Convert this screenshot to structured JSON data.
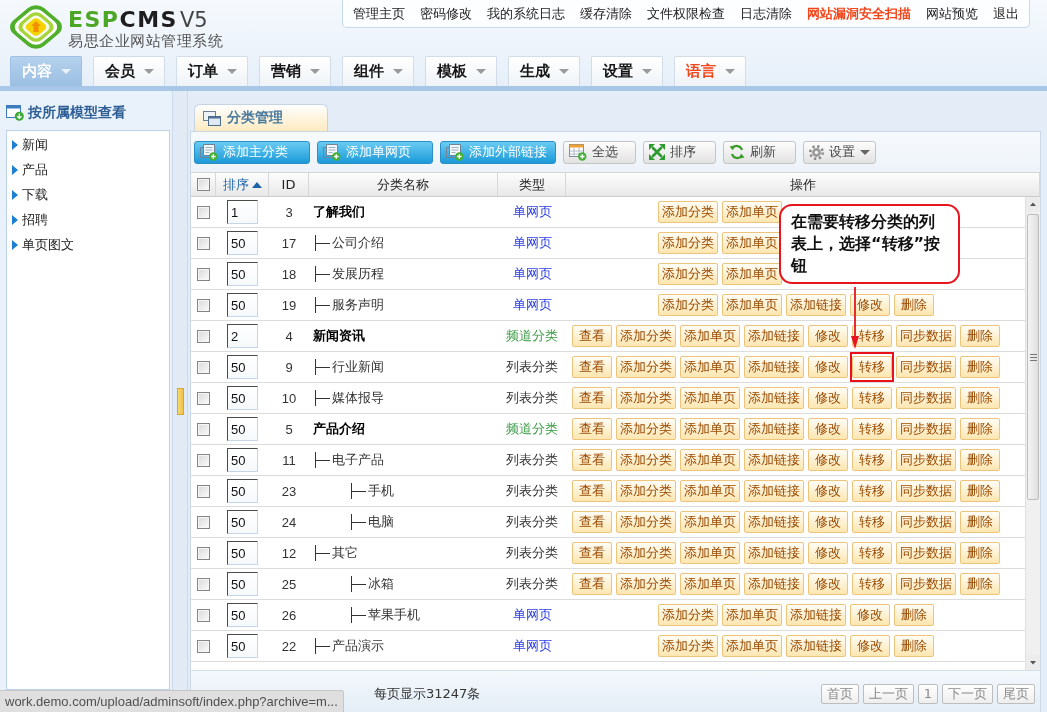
{
  "logo": {
    "wordmark_accent": "ESP",
    "wordmark_rest": "CMS",
    "version": "V5",
    "subtitle": "易思企业网站管理系统"
  },
  "top_links": [
    {
      "label": "管理主页",
      "kind": "normal"
    },
    {
      "label": "密码修改",
      "kind": "normal"
    },
    {
      "label": "我的系统日志",
      "kind": "normal"
    },
    {
      "label": "缓存清除",
      "kind": "normal"
    },
    {
      "label": "文件权限检查",
      "kind": "normal"
    },
    {
      "label": "日志清除",
      "kind": "normal"
    },
    {
      "label": "网站漏洞安全扫描",
      "kind": "alert"
    },
    {
      "label": "网站预览",
      "kind": "normal"
    },
    {
      "label": "退出",
      "kind": "normal"
    }
  ],
  "main_menu": [
    {
      "label": "内容",
      "selected": true,
      "kind": "normal"
    },
    {
      "label": "会员",
      "selected": false,
      "kind": "normal"
    },
    {
      "label": "订单",
      "selected": false,
      "kind": "normal"
    },
    {
      "label": "营销",
      "selected": false,
      "kind": "normal"
    },
    {
      "label": "组件",
      "selected": false,
      "kind": "normal"
    },
    {
      "label": "模板",
      "selected": false,
      "kind": "normal"
    },
    {
      "label": "生成",
      "selected": false,
      "kind": "normal"
    },
    {
      "label": "设置",
      "selected": false,
      "kind": "normal"
    },
    {
      "label": "语言",
      "selected": false,
      "kind": "alert"
    }
  ],
  "sidebar": {
    "title": "按所属模型查看",
    "items": [
      "新闻",
      "产品",
      "下载",
      "招聘",
      "单页图文"
    ]
  },
  "panel_tab": {
    "label": "分类管理"
  },
  "toolbar": [
    {
      "label": "添加主分类",
      "kind": "primary"
    },
    {
      "label": "添加单网页",
      "kind": "primary"
    },
    {
      "label": "添加外部链接",
      "kind": "primary"
    },
    {
      "label": "全选",
      "kind": "secondary"
    },
    {
      "label": "排序",
      "kind": "secondary"
    },
    {
      "label": "刷新",
      "kind": "secondary"
    },
    {
      "label": "设置",
      "kind": "dropdown"
    }
  ],
  "table": {
    "select_all": {
      "checked": false
    },
    "columns": [
      {
        "label": "排序",
        "sorted": true
      },
      {
        "label": "ID",
        "sorted": false
      },
      {
        "label": "分类名称",
        "sorted": false
      },
      {
        "label": "类型",
        "sorted": false
      },
      {
        "label": "操作",
        "sorted": false
      }
    ],
    "rows": [
      {
        "checked": false,
        "order": "1",
        "id": "3",
        "name": "了解我们",
        "type": {
          "label": "单网页",
          "kind": "page"
        },
        "actions": [
          {
            "label": "添加分类",
            "highlighted": false
          },
          {
            "label": "添加单页",
            "highlighted": false
          }
        ],
        "children": [
          {
            "checked": false,
            "order": "50",
            "id": "17",
            "name": "公司介绍",
            "type": {
              "label": "单网页",
              "kind": "page"
            },
            "actions": [
              {
                "label": "添加分类",
                "highlighted": false
              },
              {
                "label": "添加单页",
                "highlighted": false
              }
            ]
          },
          {
            "checked": false,
            "order": "50",
            "id": "18",
            "name": "发展历程",
            "type": {
              "label": "单网页",
              "kind": "page"
            },
            "actions": [
              {
                "label": "添加分类",
                "highlighted": false
              },
              {
                "label": "添加单页",
                "highlighted": false
              }
            ]
          },
          {
            "checked": false,
            "order": "50",
            "id": "19",
            "name": "服务声明",
            "type": {
              "label": "单网页",
              "kind": "page"
            },
            "actions": [
              {
                "label": "添加分类",
                "highlighted": false
              },
              {
                "label": "添加单页",
                "highlighted": false
              },
              {
                "label": "添加链接",
                "highlighted": false
              },
              {
                "label": "修改",
                "highlighted": false
              },
              {
                "label": "删除",
                "highlighted": false
              }
            ]
          }
        ]
      },
      {
        "checked": false,
        "order": "2",
        "id": "4",
        "name": "新闻资讯",
        "type": {
          "label": "频道分类",
          "kind": "channel"
        },
        "actions": [
          {
            "label": "查看",
            "highlighted": false
          },
          {
            "label": "添加分类",
            "highlighted": false
          },
          {
            "label": "添加单页",
            "highlighted": false
          },
          {
            "label": "添加链接",
            "highlighted": false
          },
          {
            "label": "修改",
            "highlighted": false
          },
          {
            "label": "转移",
            "highlighted": false
          },
          {
            "label": "同步数据",
            "highlighted": false
          },
          {
            "label": "删除",
            "highlighted": false
          }
        ],
        "children": [
          {
            "checked": false,
            "order": "50",
            "id": "9",
            "name": "行业新闻",
            "type": {
              "label": "列表分类",
              "kind": "list"
            },
            "actions": [
              {
                "label": "查看",
                "highlighted": false
              },
              {
                "label": "添加分类",
                "highlighted": false
              },
              {
                "label": "添加单页",
                "highlighted": false
              },
              {
                "label": "添加链接",
                "highlighted": false
              },
              {
                "label": "修改",
                "highlighted": false
              },
              {
                "label": "转移",
                "highlighted": true
              },
              {
                "label": "同步数据",
                "highlighted": false
              },
              {
                "label": "删除",
                "highlighted": false
              }
            ]
          },
          {
            "checked": false,
            "order": "50",
            "id": "10",
            "name": "媒体报导",
            "type": {
              "label": "列表分类",
              "kind": "list"
            },
            "actions": [
              {
                "label": "查看",
                "highlighted": false
              },
              {
                "label": "添加分类",
                "highlighted": false
              },
              {
                "label": "添加单页",
                "highlighted": false
              },
              {
                "label": "添加链接",
                "highlighted": false
              },
              {
                "label": "修改",
                "highlighted": false
              },
              {
                "label": "转移",
                "highlighted": false
              },
              {
                "label": "同步数据",
                "highlighted": false
              },
              {
                "label": "删除",
                "highlighted": false
              }
            ]
          }
        ]
      },
      {
        "checked": false,
        "order": "50",
        "id": "5",
        "name": "产品介绍",
        "type": {
          "label": "频道分类",
          "kind": "channel"
        },
        "actions": [
          {
            "label": "查看",
            "highlighted": false
          },
          {
            "label": "添加分类",
            "highlighted": false
          },
          {
            "label": "添加单页",
            "highlighted": false
          },
          {
            "label": "添加链接",
            "highlighted": false
          },
          {
            "label": "修改",
            "highlighted": false
          },
          {
            "label": "转移",
            "highlighted": false
          },
          {
            "label": "同步数据",
            "highlighted": false
          },
          {
            "label": "删除",
            "highlighted": false
          }
        ],
        "children": [
          {
            "checked": false,
            "order": "50",
            "id": "11",
            "name": "电子产品",
            "type": {
              "label": "列表分类",
              "kind": "list"
            },
            "actions": [
              {
                "label": "查看",
                "highlighted": false
              },
              {
                "label": "添加分类",
                "highlighted": false
              },
              {
                "label": "添加单页",
                "highlighted": false
              },
              {
                "label": "添加链接",
                "highlighted": false
              },
              {
                "label": "修改",
                "highlighted": false
              },
              {
                "label": "转移",
                "highlighted": false
              },
              {
                "label": "同步数据",
                "highlighted": false
              },
              {
                "label": "删除",
                "highlighted": false
              }
            ],
            "children": [
              {
                "checked": false,
                "order": "50",
                "id": "23",
                "name": "手机",
                "type": {
                  "label": "列表分类",
                  "kind": "list"
                },
                "actions": [
                  {
                    "label": "查看",
                    "highlighted": false
                  },
                  {
                    "label": "添加分类",
                    "highlighted": false
                  },
                  {
                    "label": "添加单页",
                    "highlighted": false
                  },
                  {
                    "label": "添加链接",
                    "highlighted": false
                  },
                  {
                    "label": "修改",
                    "highlighted": false
                  },
                  {
                    "label": "转移",
                    "highlighted": false
                  },
                  {
                    "label": "同步数据",
                    "highlighted": false
                  },
                  {
                    "label": "删除",
                    "highlighted": false
                  }
                ]
              },
              {
                "checked": false,
                "order": "50",
                "id": "24",
                "name": "电脑",
                "type": {
                  "label": "列表分类",
                  "kind": "list"
                },
                "actions": [
                  {
                    "label": "查看",
                    "highlighted": false
                  },
                  {
                    "label": "添加分类",
                    "highlighted": false
                  },
                  {
                    "label": "添加单页",
                    "highlighted": false
                  },
                  {
                    "label": "添加链接",
                    "highlighted": false
                  },
                  {
                    "label": "修改",
                    "highlighted": false
                  },
                  {
                    "label": "转移",
                    "highlighted": false
                  },
                  {
                    "label": "同步数据",
                    "highlighted": false
                  },
                  {
                    "label": "删除",
                    "highlighted": false
                  }
                ]
              }
            ]
          },
          {
            "checked": false,
            "order": "50",
            "id": "12",
            "name": "其它",
            "type": {
              "label": "列表分类",
              "kind": "list"
            },
            "actions": [
              {
                "label": "查看",
                "highlighted": false
              },
              {
                "label": "添加分类",
                "highlighted": false
              },
              {
                "label": "添加单页",
                "highlighted": false
              },
              {
                "label": "添加链接",
                "highlighted": false
              },
              {
                "label": "修改",
                "highlighted": false
              },
              {
                "label": "转移",
                "highlighted": false
              },
              {
                "label": "同步数据",
                "highlighted": false
              },
              {
                "label": "删除",
                "highlighted": false
              }
            ],
            "children": [
              {
                "checked": false,
                "order": "50",
                "id": "25",
                "name": "冰箱",
                "type": {
                  "label": "列表分类",
                  "kind": "list"
                },
                "actions": [
                  {
                    "label": "查看",
                    "highlighted": false
                  },
                  {
                    "label": "添加分类",
                    "highlighted": false
                  },
                  {
                    "label": "添加单页",
                    "highlighted": false
                  },
                  {
                    "label": "添加链接",
                    "highlighted": false
                  },
                  {
                    "label": "修改",
                    "highlighted": false
                  },
                  {
                    "label": "转移",
                    "highlighted": false
                  },
                  {
                    "label": "同步数据",
                    "highlighted": false
                  },
                  {
                    "label": "删除",
                    "highlighted": false
                  }
                ]
              },
              {
                "checked": false,
                "order": "50",
                "id": "26",
                "name": "苹果手机",
                "type": {
                  "label": "单网页",
                  "kind": "page"
                },
                "actions": [
                  {
                    "label": "添加分类",
                    "highlighted": false
                  },
                  {
                    "label": "添加单页",
                    "highlighted": false
                  },
                  {
                    "label": "添加链接",
                    "highlighted": false
                  },
                  {
                    "label": "修改",
                    "highlighted": false
                  },
                  {
                    "label": "删除",
                    "highlighted": false
                  }
                ]
              }
            ]
          },
          {
            "checked": false,
            "order": "50",
            "id": "22",
            "name": "产品演示",
            "type": {
              "label": "单网页",
              "kind": "page"
            },
            "actions": [
              {
                "label": "添加分类",
                "highlighted": false
              },
              {
                "label": "添加单页",
                "highlighted": false
              },
              {
                "label": "添加链接",
                "highlighted": false
              },
              {
                "label": "修改",
                "highlighted": false
              },
              {
                "label": "删除",
                "highlighted": false
              }
            ]
          }
        ]
      }
    ]
  },
  "annotation": {
    "callout": "在需要转移分类的列表上，选择“转移”按钮"
  },
  "footer": {
    "summary": "每页显示31247条",
    "pages": [
      "首页",
      "上一页",
      "1",
      "下一页",
      "尾页"
    ]
  },
  "status_url": "work.demo.com/upload/adminsoft/index.php?archive=m..."
}
